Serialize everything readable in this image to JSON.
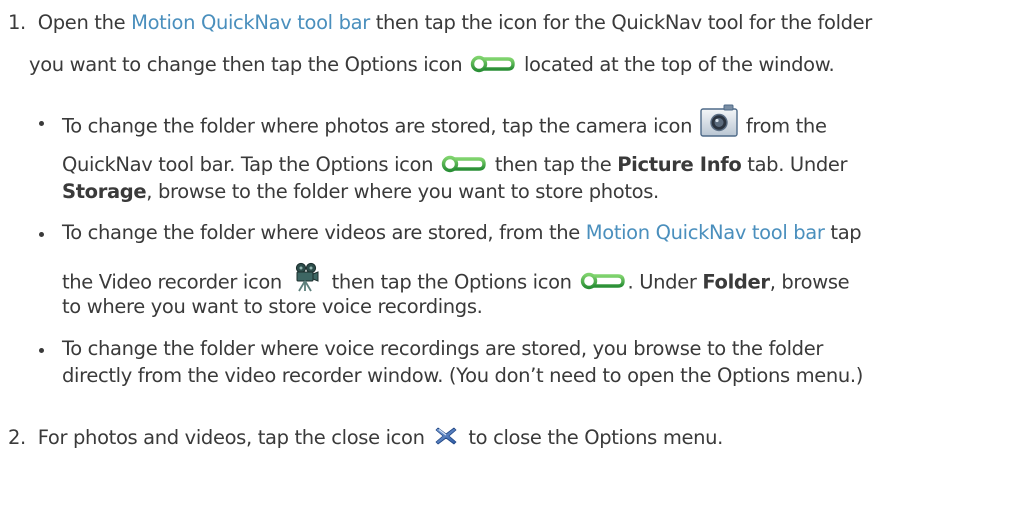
{
  "steps": [
    {
      "number": "1.",
      "seg1": "Open the ",
      "link": "Motion QuickNav tool bar",
      "seg2": " then tap the icon for the QuickNav tool for the folder",
      "line2_before": "you want to change then tap the Options icon",
      "line2_after": " located at the top of the window."
    },
    {
      "number": "2.",
      "before": "For photos and videos, tap the close icon",
      "after": " to close the Options menu."
    }
  ],
  "bullets": [
    {
      "l1_before": "To change the folder where photos are stored, tap the camera icon",
      "l1_after": " from the",
      "l2_before": "QuickNav tool bar. Tap the Options icon",
      "l2_mid": " then tap the ",
      "l2_bold": "Picture Info",
      "l2_after": " tab. Under",
      "l3_bold": "Storage",
      "l3_after": ", browse to the folder where you want to store photos."
    },
    {
      "l1_before": "To change the folder where videos are stored, from the ",
      "l1_link": "Motion QuickNav tool bar",
      "l1_after": " tap",
      "l2_before": "the Video recorder icon",
      "l2_mid": " then tap the Options icon",
      "l2_mid2": ". Under ",
      "l2_bold": "Folder",
      "l2_after": ", browse",
      "l3": "to where you want to store voice recordings."
    },
    {
      "l1": "To change the folder where voice recordings are stored, you browse to the folder",
      "l2": "directly from the video recorder window. (You don’t need to open the Options menu.)"
    }
  ],
  "icons": {
    "options": "options-icon",
    "camera": "camera-icon",
    "video_recorder": "video-recorder-icon",
    "close": "close-icon"
  },
  "colors": {
    "text": "#3a3a3a",
    "link": "#4a8fbd",
    "icon_green": "#2f9d3a"
  }
}
